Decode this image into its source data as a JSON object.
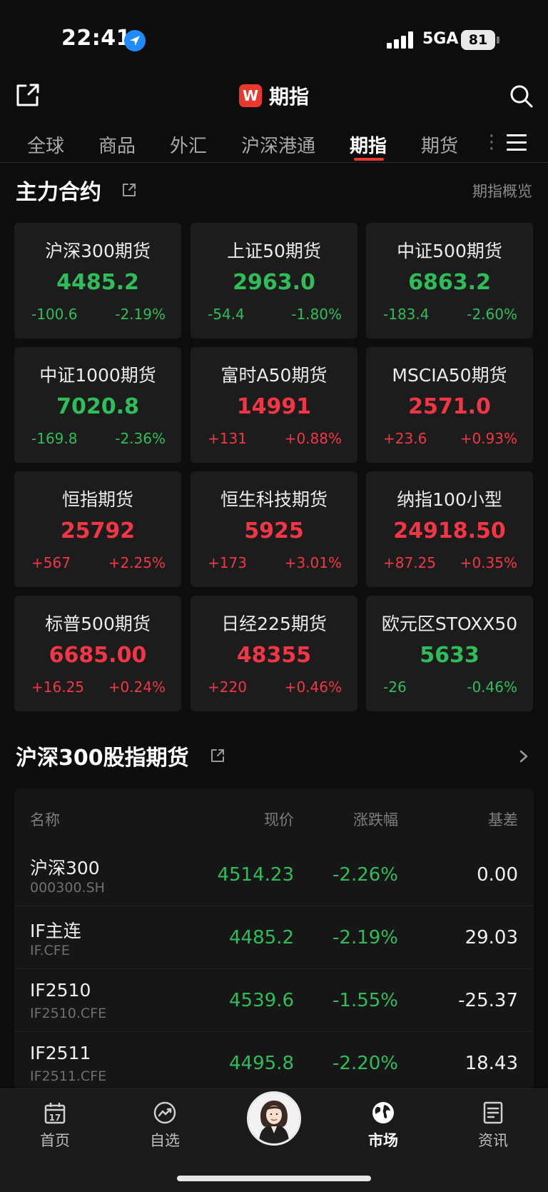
{
  "status_bar": {
    "time": "22:41",
    "network": "5GA",
    "battery": "81"
  },
  "header": {
    "logo_letter": "W",
    "title": "期指"
  },
  "tabs": [
    {
      "label": "全球",
      "active": false
    },
    {
      "label": "商品",
      "active": false
    },
    {
      "label": "外汇",
      "active": false
    },
    {
      "label": "沪深港通",
      "active": false
    },
    {
      "label": "期指",
      "active": true
    },
    {
      "label": "期货",
      "active": false
    }
  ],
  "section_main": {
    "title": "主力合约",
    "link": "期指概览",
    "cards": [
      {
        "name": "沪深300期货",
        "price": "4485.2",
        "change": "-100.6",
        "pct": "-2.19%",
        "dir": "down"
      },
      {
        "name": "上证50期货",
        "price": "2963.0",
        "change": "-54.4",
        "pct": "-1.80%",
        "dir": "down"
      },
      {
        "name": "中证500期货",
        "price": "6863.2",
        "change": "-183.4",
        "pct": "-2.60%",
        "dir": "down"
      },
      {
        "name": "中证1000期货",
        "price": "7020.8",
        "change": "-169.8",
        "pct": "-2.36%",
        "dir": "down"
      },
      {
        "name": "富时A50期货",
        "price": "14991",
        "change": "+131",
        "pct": "+0.88%",
        "dir": "up"
      },
      {
        "name": "MSCIA50期货",
        "price": "2571.0",
        "change": "+23.6",
        "pct": "+0.93%",
        "dir": "up"
      },
      {
        "name": "恒指期货",
        "price": "25792",
        "change": "+567",
        "pct": "+2.25%",
        "dir": "up"
      },
      {
        "name": "恒生科技期货",
        "price": "5925",
        "change": "+173",
        "pct": "+3.01%",
        "dir": "up"
      },
      {
        "name": "纳指100小型",
        "price": "24918.50",
        "change": "+87.25",
        "pct": "+0.35%",
        "dir": "up"
      },
      {
        "name": "标普500期货",
        "price": "6685.00",
        "change": "+16.25",
        "pct": "+0.24%",
        "dir": "up"
      },
      {
        "name": "日经225期货",
        "price": "48355",
        "change": "+220",
        "pct": "+0.46%",
        "dir": "up"
      },
      {
        "name": "欧元区STOXX50",
        "price": "5633",
        "change": "-26",
        "pct": "-0.46%",
        "dir": "down"
      }
    ]
  },
  "section_hs300": {
    "title": "沪深300股指期货",
    "columns": {
      "name": "名称",
      "price": "现价",
      "pct": "涨跌幅",
      "basis": "基差"
    },
    "rows": [
      {
        "name": "沪深300",
        "code": "000300.SH",
        "price": "4514.23",
        "pct": "-2.26%",
        "basis": "0.00",
        "dir": "down"
      },
      {
        "name": "IF主连",
        "code": "IF.CFE",
        "price": "4485.2",
        "pct": "-2.19%",
        "basis": "29.03",
        "dir": "down"
      },
      {
        "name": "IF2510",
        "code": "IF2510.CFE",
        "price": "4539.6",
        "pct": "-1.55%",
        "basis": "-25.37",
        "dir": "down"
      },
      {
        "name": "IF2511",
        "code": "IF2511.CFE",
        "price": "4495.8",
        "pct": "-2.20%",
        "basis": "18.43",
        "dir": "down"
      }
    ]
  },
  "bottom_nav": [
    {
      "label": "首页",
      "icon": "calendar-icon",
      "date_num": "17",
      "active": false
    },
    {
      "label": "自选",
      "icon": "trend-icon",
      "active": false
    },
    {
      "label": "市场",
      "icon": "globe-icon",
      "active": true
    },
    {
      "label": "资讯",
      "icon": "news-icon",
      "active": false
    }
  ],
  "colors": {
    "up": "#f23645",
    "down": "#2ebd59",
    "accent": "#e8392c"
  }
}
